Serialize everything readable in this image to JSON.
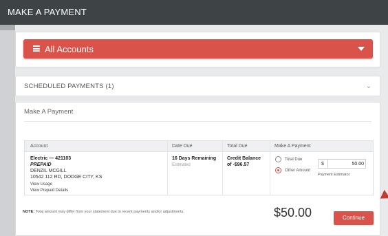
{
  "page": {
    "title": "MAKE A PAYMENT"
  },
  "account_selector": {
    "label": "All Accounts",
    "menu_icon": "menu-icon",
    "caret_icon": "caret-down-icon"
  },
  "scheduled": {
    "label": "SCHEDULED PAYMENTS (1)",
    "chevron": "⌄"
  },
  "payment": {
    "heading": "Make A Payment",
    "columns": [
      "Account",
      "Date Due",
      "Total Due",
      "Make A Payment"
    ],
    "row": {
      "account_name": "Electric — 421103",
      "account_type": "PREPAID",
      "customer": "DENZIL MCGILL",
      "address": "10542 112 RD, DODGE CITY, KS",
      "view_usage": "View Usage",
      "view_prepaid": "View Prepaid Details",
      "date_due": "16 Days Remaining",
      "date_due_note": "Estimated",
      "total_due_line1": "Credit Balance",
      "total_due_line2": "of -$96.57",
      "option_total": "Total Due",
      "option_other": "Other Amount",
      "selected_option": "Other Amount",
      "currency": "$",
      "amount": "50.00",
      "estimator": "Payment Estimator"
    },
    "note_label": "NOTE:",
    "note_text": "Total amount may differ from your statement due to recent payments and/or adjustments.",
    "total": "$50.00",
    "continue_label": "Continue"
  },
  "colors": {
    "accent": "#d9534a",
    "topbar": "#3e4346"
  }
}
